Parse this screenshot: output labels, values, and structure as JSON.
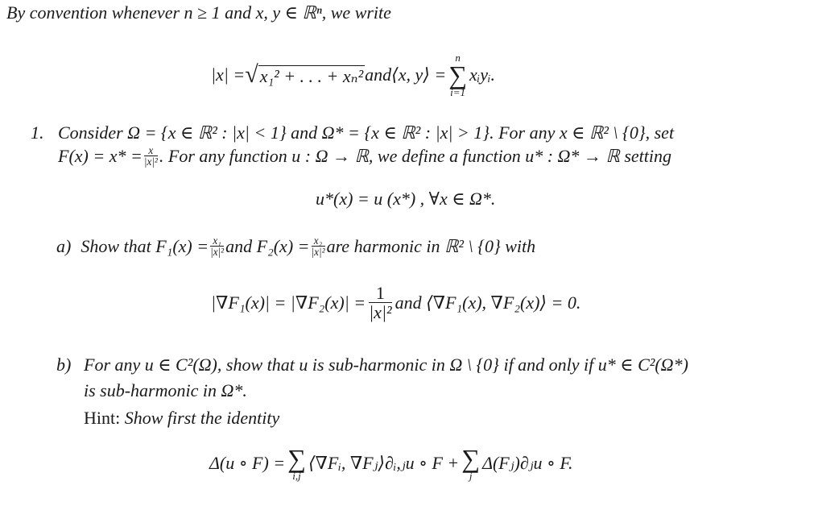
{
  "intro": {
    "text": "By convention whenever n ≥ 1 and x, y ∈ ℝⁿ, we write"
  },
  "definitions": {
    "norm_lhs": "|x| = ",
    "norm_rhs": "x₁² + . . . + xₙ²",
    "connector": " and ",
    "inner_lhs": "⟨x, y⟩ = ",
    "sum_top": "n",
    "sum_bottom": "i=1",
    "inner_rhs": "xᵢyᵢ."
  },
  "problem": {
    "number": "1.",
    "line1": "Consider Ω = {x ∈ ℝ² : |x| < 1} and Ω* = {x ∈ ℝ² : |x| > 1}. For any x ∈ ℝ² \\ {0}, set",
    "line2_prefix": "F(x) = x* = ",
    "line2_frac_num": "x",
    "line2_frac_den": "|x|²",
    "line2_suffix": ". For any function u : Ω → ℝ, we define a function u* : Ω* → ℝ setting",
    "display_eq": "u*(x) = u (x*) , ∀x ∈ Ω*."
  },
  "part_a": {
    "label": "a)",
    "text_prefix": "Show that F₁(x) = ",
    "f1_num": "x₁",
    "f1_den": "|x|²",
    "text_mid": " and F₂(x) = ",
    "f2_num": "x₂",
    "f2_den": "|x|²",
    "text_suffix": " are harmonic in ℝ² \\ {0} with",
    "eq_lhs": "|∇F₁(x)| = |∇F₂(x)| = ",
    "eq_frac_num": "1",
    "eq_frac_den": "|x|²",
    "eq_rhs": " and ⟨∇F₁(x), ∇F₂(x)⟩ = 0."
  },
  "part_b": {
    "label": "b)",
    "line1": "For any u ∈ C²(Ω), show that u is sub-harmonic in Ω \\ {0} if and only if u* ∈ C²(Ω*)",
    "line2": "is sub-harmonic in Ω*.",
    "hint_label": "Hint:",
    "hint_text": " Show first the identity",
    "identity_lhs": "Δ(u ∘ F) = ",
    "sum1_bottom": "i,j",
    "identity_mid": "⟨∇Fᵢ, ∇Fⱼ⟩∂ᵢ,ⱼu ∘ F + ",
    "sum2_bottom": "j",
    "identity_rhs": "Δ(Fⱼ)∂ⱼu ∘ F."
  }
}
